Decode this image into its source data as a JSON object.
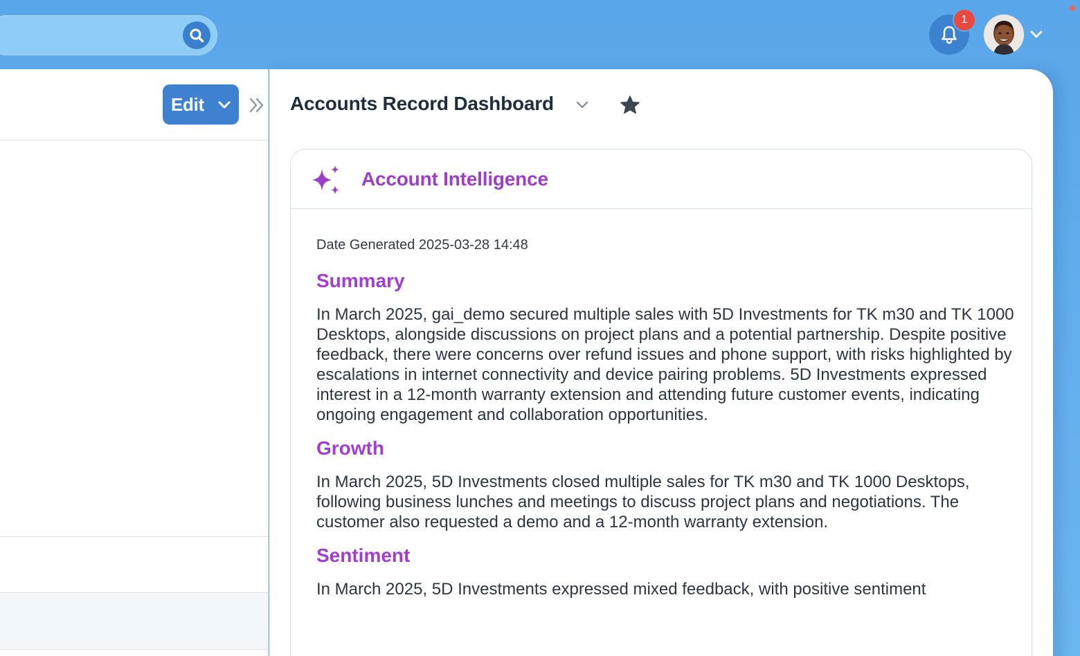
{
  "topbar": {
    "search": {
      "value": "",
      "placeholder": ""
    },
    "notifications": {
      "count": "1"
    }
  },
  "left_pane": {
    "edit_button_label": "Edit"
  },
  "dashboard": {
    "title": "Accounts Record Dashboard",
    "card": {
      "title": "Account Intelligence",
      "date_generated": "Date Generated 2025-03-28 14:48",
      "sections": [
        {
          "heading": "Summary",
          "text": "In March 2025, gai_demo secured multiple sales with 5D Investments for TK m30 and TK 1000 Desktops, alongside discussions on project plans and a potential partnership. Despite positive feedback, there were concerns over refund issues and phone support, with risks highlighted by escalations in internet connectivity and device pairing problems. 5D Investments expressed interest in a 12-month warranty extension and attending future customer events, indicating ongoing engagement and collaboration opportunities."
        },
        {
          "heading": "Growth",
          "text": "In March 2025, 5D Investments closed multiple sales for TK m30 and TK 1000 Desktops, following business lunches and meetings to discuss project plans and negotiations. The customer also requested a demo and a 12-month warranty extension."
        },
        {
          "heading": "Sentiment",
          "text": "In March 2025, 5D Investments expressed mixed feedback, with positive sentiment"
        }
      ]
    }
  },
  "colors": {
    "topbar_bg": "#5aa6ea",
    "primary_button": "#3e81d1",
    "accent_purple": "#a03fcb",
    "badge_red": "#e9493f"
  },
  "icons": {
    "search": "search-icon",
    "bell": "bell-icon",
    "avatar_caret": "chevron-down-icon",
    "collapse": "double-chevron-right-icon",
    "title_caret": "chevron-down-icon",
    "favorite": "star-icon",
    "ai": "sparkle-icon"
  }
}
